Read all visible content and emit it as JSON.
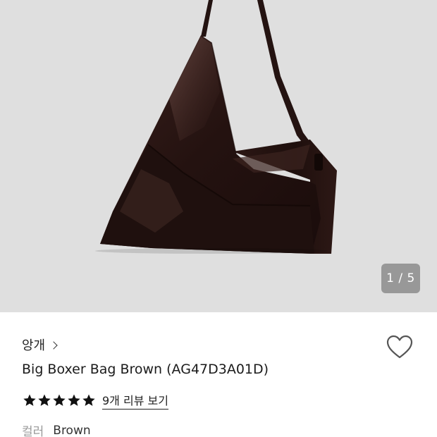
{
  "gallery": {
    "counter": "1 / 5",
    "current": 1,
    "total": 5,
    "background": "#dfdfdf"
  },
  "product": {
    "brand": "앙개",
    "title": "Big Boxer Bag Brown (AG47D3A01D)",
    "rating_stars": 5,
    "review_link": "9개 리뷰 보기",
    "color_label": "컬러",
    "color_value": "Brown"
  },
  "icons": {
    "brand_link": "chevron-right-icon",
    "wishlist": "heart-outline-icon",
    "rating": "star-icon"
  },
  "colors": {
    "bag": "#2a1613",
    "star": "#111111",
    "muted_text": "#9a9a9a"
  }
}
